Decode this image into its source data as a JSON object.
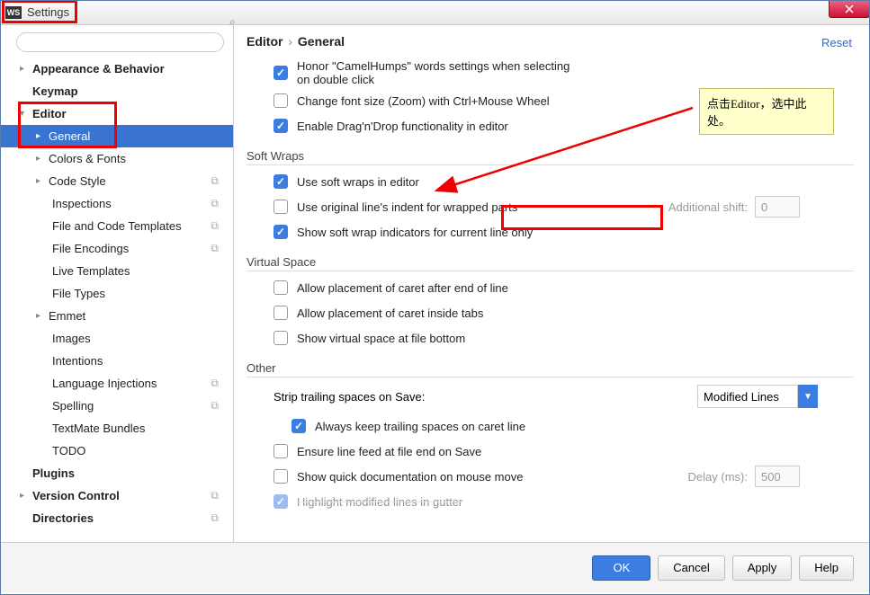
{
  "window": {
    "title": "Settings",
    "app_icon": "WS"
  },
  "sidebar": {
    "search_placeholder": "",
    "items": [
      {
        "label": "Appearance & Behavior"
      },
      {
        "label": "Keymap"
      },
      {
        "label": "Editor"
      },
      {
        "label": "General"
      },
      {
        "label": "Colors & Fonts"
      },
      {
        "label": "Code Style"
      },
      {
        "label": "Inspections"
      },
      {
        "label": "File and Code Templates"
      },
      {
        "label": "File Encodings"
      },
      {
        "label": "Live Templates"
      },
      {
        "label": "File Types"
      },
      {
        "label": "Emmet"
      },
      {
        "label": "Images"
      },
      {
        "label": "Intentions"
      },
      {
        "label": "Language Injections"
      },
      {
        "label": "Spelling"
      },
      {
        "label": "TextMate Bundles"
      },
      {
        "label": "TODO"
      },
      {
        "label": "Plugins"
      },
      {
        "label": "Version Control"
      },
      {
        "label": "Directories"
      }
    ]
  },
  "breadcrumb": {
    "a": "Editor",
    "b": "General"
  },
  "reset": "Reset",
  "options": {
    "honor": "Honor \"CamelHumps\" words settings when selecting on double click",
    "zoom": "Change font size (Zoom) with Ctrl+Mouse Wheel",
    "dnd": "Enable Drag'n'Drop functionality in editor",
    "softwraps_title": "Soft Wraps",
    "use_soft": "Use soft wraps in editor",
    "orig_indent": "Use original line's indent for wrapped parts",
    "add_shift_label": "Additional shift:",
    "add_shift_val": "0",
    "show_ind": "Show soft wrap indicators for current line only",
    "vspace_title": "Virtual Space",
    "caret_eol": "Allow placement of caret after end of line",
    "caret_tabs": "Allow placement of caret inside tabs",
    "vspace_bottom": "Show virtual space at file bottom",
    "other_title": "Other",
    "strip_label": "Strip trailing spaces on Save:",
    "strip_value": "Modified Lines",
    "keep_trail": "Always keep trailing spaces on caret line",
    "ensure_lf": "Ensure line feed at file end on Save",
    "quick_doc": "Show quick documentation on mouse move",
    "delay_label": "Delay (ms):",
    "delay_val": "500",
    "highlight_mod": "Highlight modified lines in gutter"
  },
  "note": "点击Editor，选中此处。",
  "buttons": {
    "ok": "OK",
    "cancel": "Cancel",
    "apply": "Apply",
    "help": "Help"
  }
}
